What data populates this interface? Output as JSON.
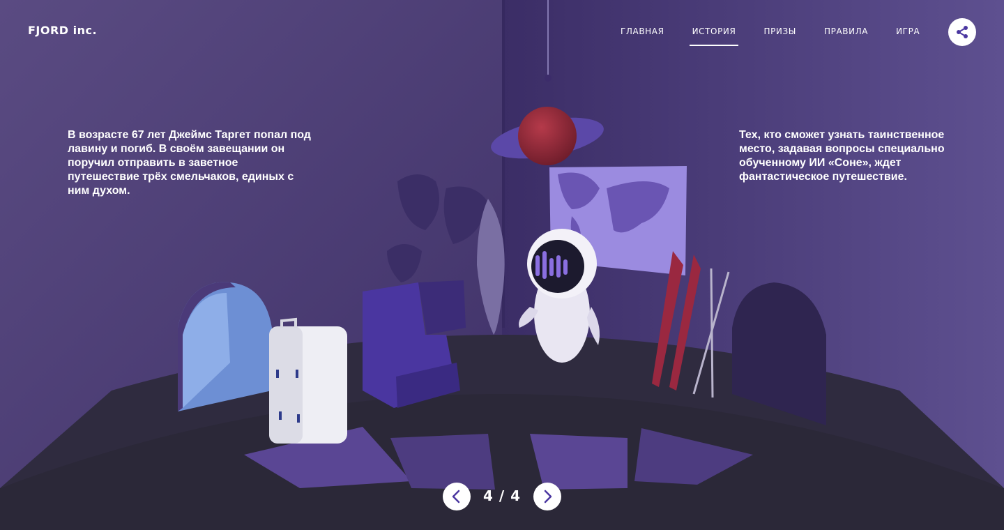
{
  "brand": {
    "logo": "FJORD inc."
  },
  "nav": {
    "items": [
      {
        "label": "ГЛАВНАЯ",
        "active": false
      },
      {
        "label": "ИСТОРИЯ",
        "active": true
      },
      {
        "label": "ПРИЗЫ",
        "active": false
      },
      {
        "label": "ПРАВИЛА",
        "active": false
      },
      {
        "label": "ИГРА",
        "active": false
      }
    ]
  },
  "share": {
    "icon": "share-icon"
  },
  "story": {
    "left": "В возрасте 67 лет Джеймс Таргет попал под лавину и погиб. В своём завещании он поручил отправить в заветное путешествие трёх смельчаков, единых с ним духом.",
    "right": "Тех, кто сможет узнать таинственное место, задавая вопросы специально обученному ИИ «Соне», ждет фантастическое путешествие."
  },
  "pager": {
    "current": 4,
    "total": 4,
    "display": "4 / 4",
    "prev_icon": "chevron-left-icon",
    "next_icon": "chevron-right-icon"
  },
  "colors": {
    "wall": "#4a3a78",
    "wall_dark": "#3a2c63",
    "floor": "#2b2838",
    "accent_purple": "#7b6bc7",
    "white": "#ffffff"
  }
}
